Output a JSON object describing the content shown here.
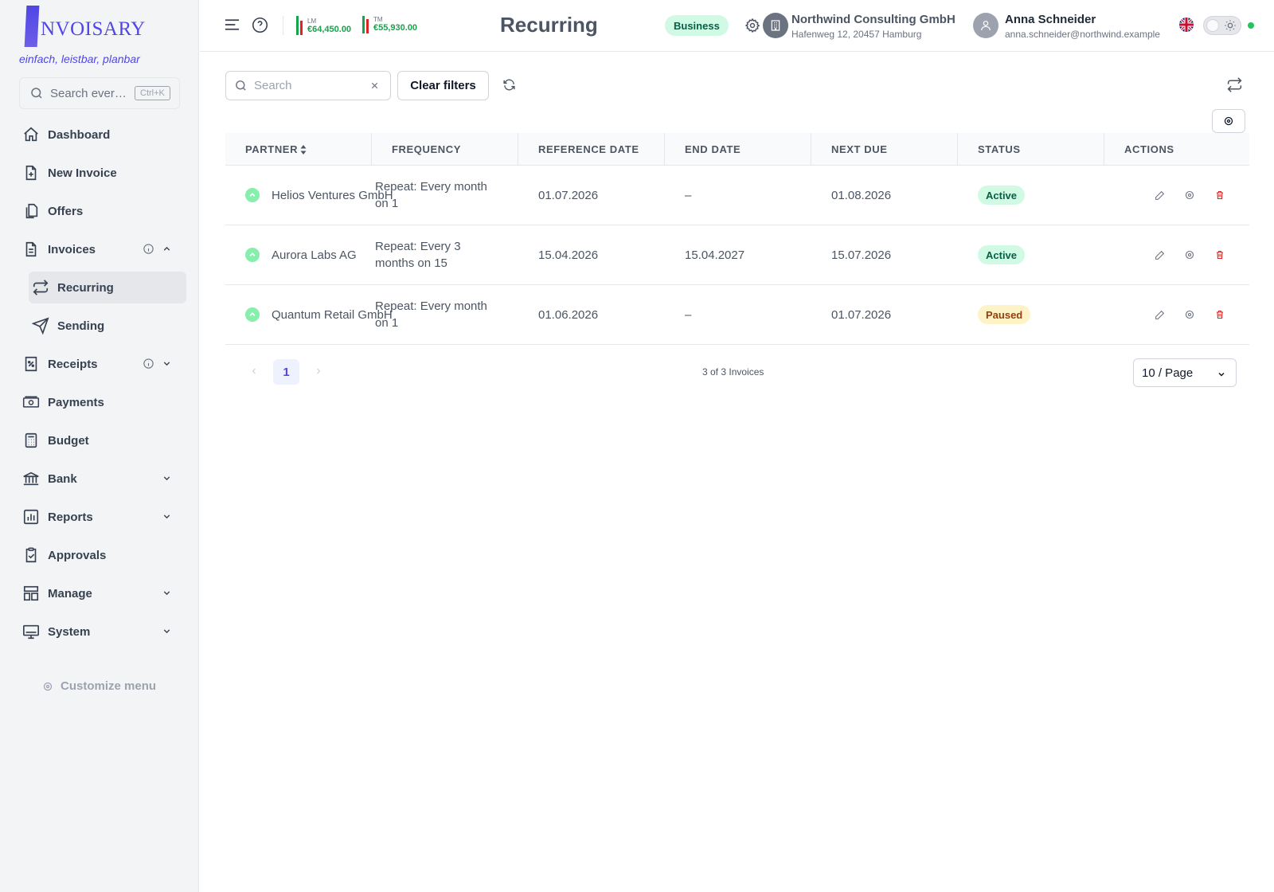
{
  "brand": {
    "logo_text": "NVOISARY",
    "slogan": "einfach, leistbar, planbar",
    "accent": "#4f46e5"
  },
  "sidebar": {
    "search_placeholder": "Search ever…",
    "search_shortcut": "Ctrl+K",
    "items": [
      {
        "label": "Dashboard",
        "icon": "home-icon"
      },
      {
        "label": "New Invoice",
        "icon": "file-plus-icon"
      },
      {
        "label": "Offers",
        "icon": "files-icon"
      },
      {
        "label": "Invoices",
        "icon": "file-icon",
        "expanded": true
      },
      {
        "label": "Recurring",
        "icon": "repeat-icon",
        "active": true
      },
      {
        "label": "Sending",
        "icon": "send-icon"
      },
      {
        "label": "Receipts",
        "icon": "receipt-icon"
      },
      {
        "label": "Payments",
        "icon": "banknote-icon"
      },
      {
        "label": "Budget",
        "icon": "calculator-icon"
      },
      {
        "label": "Bank",
        "icon": "bank-icon"
      },
      {
        "label": "Reports",
        "icon": "chart-icon"
      },
      {
        "label": "Approvals",
        "icon": "clipboard-check-icon"
      },
      {
        "label": "Manage",
        "icon": "layout-icon"
      },
      {
        "label": "System",
        "icon": "monitor-icon"
      }
    ],
    "customize_label": "Customize menu"
  },
  "header": {
    "kpi_last_month": {
      "label": "LM",
      "amount": "€64,450.00"
    },
    "kpi_this_month": {
      "label": "TM",
      "amount": "€55,930.00"
    },
    "title": "Recurring",
    "plan_badge": "Business",
    "company_name": "Northwind Consulting GmbH",
    "company_address": "Hafenweg 12, 20457 Hamburg",
    "user_name": "Anna Schneider",
    "user_email": "anna.schneider@northwind.example",
    "language": "en-GB"
  },
  "toolbar": {
    "search_placeholder": "Search",
    "search_value": "",
    "clear_filters_label": "Clear filters"
  },
  "table": {
    "columns": [
      "PARTNER",
      "FREQUENCY",
      "REFERENCE DATE",
      "END DATE",
      "NEXT DUE",
      "STATUS",
      "ACTIONS"
    ],
    "rows": [
      {
        "partner": "Helios Ventures GmbH",
        "frequency": "Repeat: Every month on 1",
        "reference_date": "01.07.2026",
        "end_date": "–",
        "next_due": "01.08.2026",
        "status": "Active"
      },
      {
        "partner": "Aurora Labs AG",
        "frequency": "Repeat: Every 3 months on 15",
        "reference_date": "15.04.2026",
        "end_date": "15.04.2027",
        "next_due": "15.07.2026",
        "status": "Active"
      },
      {
        "partner": "Quantum Retail GmbH",
        "frequency": "Repeat: Every month on 1",
        "reference_date": "01.06.2026",
        "end_date": "–",
        "next_due": "01.07.2026",
        "status": "Paused"
      }
    ]
  },
  "pagination": {
    "current_page": "1",
    "summary": "3 of 3 Invoices",
    "page_size": "10 / Page"
  },
  "colors": {
    "active_bg": "#d1fae5",
    "paused_bg": "#fef3c7",
    "delete": "#dc2626",
    "success": "#16a34a"
  }
}
